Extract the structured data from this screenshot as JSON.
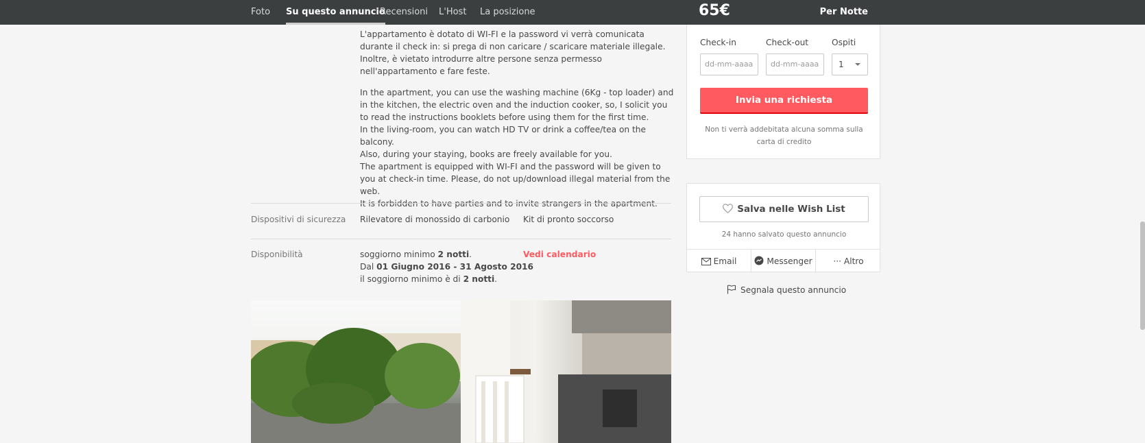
{
  "nav": {
    "tabs": [
      "Foto",
      "Su questo annuncio",
      "Recensioni",
      "L'Host",
      "La posizione"
    ],
    "active_tab": "Su questo annuncio"
  },
  "price_bar": {
    "price": "65€",
    "per": "Per Notte"
  },
  "description": {
    "italian_lines": [
      "L'appartamento è dotato di WI-FI e la password vi verrà comunicata durante il check in: si prega di non caricare / scaricare materiale illegale.",
      "Inoltre, è vietato introdurre altre persone senza permesso nell'appartamento e fare feste."
    ],
    "english_lines": [
      "In the apartment, you can use the washing machine (6Kg - top loader) and in the kitchen, the electric oven and the induction cooker, so, I solicit you to read the instructions booklets before using them for the first time.",
      "In the living-room, you can watch HD TV or drink a coffee/tea on the balcony.",
      "Also, during your staying, books are freely available for you.",
      "The apartment is equipped with WI-FI and the password will be given to you at check-in time. Please, do not up/download illegal material from the web.",
      "It is forbidden to have parties and to invite strangers in the apartment."
    ]
  },
  "safety": {
    "label": "Dispositivi di sicurezza",
    "items": [
      "Rilevatore di monossido di carbonio",
      "Kit di pronto soccorso"
    ]
  },
  "availability": {
    "label": "Disponibilità",
    "line1_prefix": "soggiorno minimo ",
    "line1_bold": "2 notti",
    "line1_suffix": ".",
    "line2_prefix": "Dal ",
    "line2_bold": "01 Giugno 2016 - 31 Agosto 2016",
    "line3_prefix": "il soggiorno minimo è di ",
    "line3_bold": "2 notti",
    "line3_suffix": ".",
    "calendar_link": "Vedi calendario"
  },
  "booking": {
    "checkin_label": "Check-in",
    "checkout_label": "Check-out",
    "guests_label": "Ospiti",
    "checkin_placeholder": "dd-mm-aaaa",
    "checkout_placeholder": "dd-mm-aaaa",
    "guests_value": "1",
    "submit_label": "Invia una richiesta",
    "note": "Non ti verrà addebitata alcuna somma sulla carta di credito"
  },
  "wishlist": {
    "button_label": "Salva nelle Wish List",
    "saved_text": "24 hanno salvato questo annuncio",
    "share": [
      "Email",
      "Messenger",
      "Altro"
    ]
  },
  "report_label": "Segnala questo annuncio",
  "colors": {
    "accent": "#ff5a5f",
    "nav_bg": "#3c3f40"
  }
}
